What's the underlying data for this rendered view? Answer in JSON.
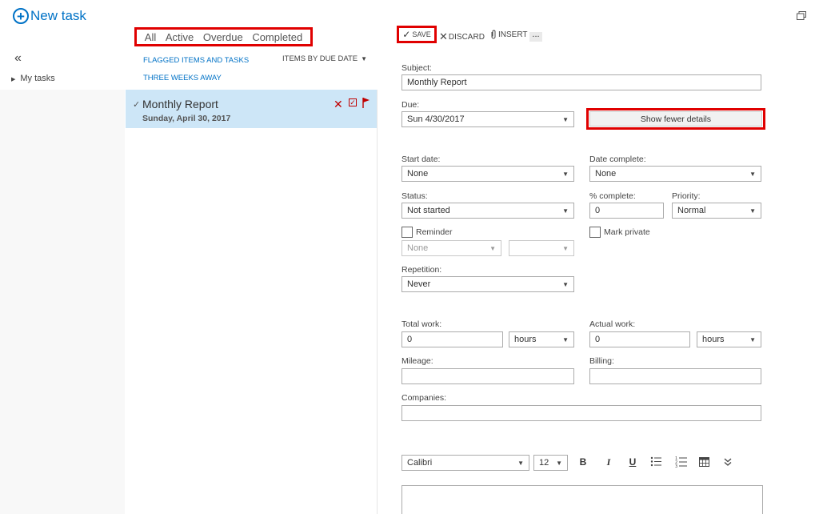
{
  "nav": {
    "new_task": "New task",
    "collapse": "«",
    "my_tasks": "My tasks"
  },
  "filters": [
    "All",
    "Active",
    "Overdue",
    "Completed"
  ],
  "list": {
    "flagged_header": "FLAGGED ITEMS AND TASKS",
    "sort_label": "ITEMS BY DUE DATE",
    "group_header": "THREE WEEKS AWAY",
    "tasks": [
      {
        "title": "Monthly Report",
        "date": "Sunday, April 30, 2017"
      }
    ]
  },
  "toolbar": {
    "save": "SAVE",
    "discard": "DISCARD",
    "insert": "INSERT",
    "more": "..."
  },
  "form": {
    "subject_label": "Subject:",
    "subject_value": "Monthly Report",
    "due_label": "Due:",
    "due_value": "Sun 4/30/2017",
    "fewer_details": "Show fewer details",
    "start_label": "Start date:",
    "start_value": "None",
    "complete_label": "Date complete:",
    "complete_value": "None",
    "status_label": "Status:",
    "status_value": "Not started",
    "percent_label": "% complete:",
    "percent_value": "0",
    "priority_label": "Priority:",
    "priority_value": "Normal",
    "reminder_label": "Reminder",
    "reminder_value": "None",
    "private_label": "Mark private",
    "repetition_label": "Repetition:",
    "repetition_value": "Never",
    "total_work_label": "Total work:",
    "total_work_value": "0",
    "total_work_unit": "hours",
    "actual_work_label": "Actual work:",
    "actual_work_value": "0",
    "actual_work_unit": "hours",
    "mileage_label": "Mileage:",
    "billing_label": "Billing:",
    "companies_label": "Companies:"
  },
  "editor": {
    "font": "Calibri",
    "size": "12",
    "bold": "B",
    "italic": "I",
    "underline": "U"
  },
  "colors": {
    "accent": "#0072c6",
    "highlight": "#e00000",
    "selected_row": "#cde6f7",
    "delete_red": "#c00000"
  }
}
